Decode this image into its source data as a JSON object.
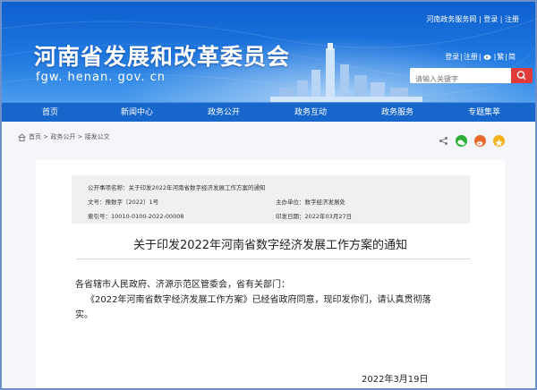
{
  "header": {
    "site_title": "河南省发展和改革委员会",
    "site_domain": "fgw. henan. gov. cn",
    "top_links": "河南政务服务网 | 登录 | 注册",
    "aux_links": {
      "login": "登录",
      "register": "注册",
      "simplified": "繁",
      "traditional": "简"
    },
    "search_placeholder": "请输入关键字"
  },
  "nav": {
    "items": [
      "首页",
      "新闻中心",
      "政务公开",
      "政务互动",
      "政务服务",
      "专题集萃"
    ]
  },
  "breadcrumb": {
    "path": "首页 > 政务公开 > 接发公文"
  },
  "meta": {
    "subject_label": "公开事项名称：",
    "subject_value": "关于印发2022年河南省数字经济发展工作方案的通知",
    "doc_no_label": "文号：",
    "doc_no_value": "豫数字〔2022〕1号",
    "issuer_label": "主办单位：",
    "issuer_value": "数字经济发展处",
    "index_label": "索引号：",
    "index_value": "10010-0100-2022-00008",
    "date_label": "印发日期：",
    "date_value": "2022年03月27日"
  },
  "article": {
    "title": "关于印发2022年河南省数字经济发展工作方案的通知",
    "salutation": "各省辖市人民政府、济源示范区管委会，省有关部门：",
    "body_line1": "《2022年河南省数字经济发展工作方案》已经省政府同意，现印发你们，请认真贯彻落",
    "body_line2": "实。",
    "date": "2022年3月19日"
  },
  "colors": {
    "banner_blue": "#1f78e0",
    "nav_blue": "#1766cc",
    "search_button": "#e23a3a",
    "frame_border": "#6f8fc8"
  },
  "icons": {
    "share": "share-icon",
    "wechat": "wechat-icon",
    "weibo": "weibo-icon",
    "qzone": "qzone-icon",
    "search": "search-icon",
    "home": "home-icon"
  }
}
